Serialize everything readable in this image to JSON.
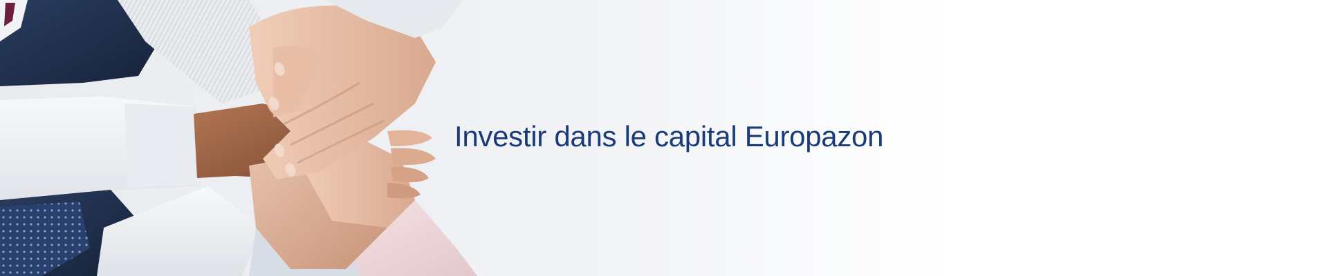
{
  "hero": {
    "headline": "Investir dans le capital Europazon",
    "image_subject": "stacked-hands-teamwork-photo"
  },
  "colors": {
    "headline": "#1b3a78",
    "background": "#ffffff",
    "backdrop": "#eceff2"
  }
}
